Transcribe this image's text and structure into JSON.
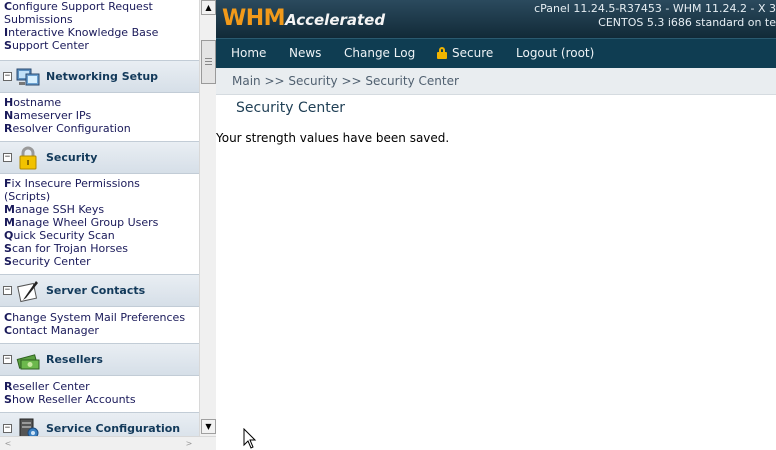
{
  "sidebar": {
    "top_links": [
      {
        "initial": "C",
        "rest": "onfigure Support Request"
      },
      {
        "initial": "",
        "rest": "Submissions"
      },
      {
        "initial": "I",
        "rest": "nteractive Knowledge Base"
      },
      {
        "initial": "S",
        "rest": "upport Center"
      }
    ],
    "sections": [
      {
        "title": "Networking Setup",
        "icon": "network-icon",
        "links": [
          {
            "initial": "H",
            "rest": "ostname"
          },
          {
            "initial": "N",
            "rest": "ameserver IPs"
          },
          {
            "initial": "R",
            "rest": "esolver Configuration"
          }
        ]
      },
      {
        "title": "Security",
        "icon": "padlock-icon",
        "links": [
          {
            "initial": "F",
            "rest": "ix Insecure Permissions"
          },
          {
            "initial": "",
            "rest": "(Scripts)"
          },
          {
            "initial": "M",
            "rest": "anage SSH Keys"
          },
          {
            "initial": "M",
            "rest": "anage Wheel Group Users"
          },
          {
            "initial": "Q",
            "rest": "uick Security Scan"
          },
          {
            "initial": "S",
            "rest": "can for Trojan Horses"
          },
          {
            "initial": "S",
            "rest": "ecurity Center"
          }
        ]
      },
      {
        "title": "Server Contacts",
        "icon": "contact-pen-icon",
        "links": [
          {
            "initial": "C",
            "rest": "hange System Mail Preferences"
          },
          {
            "initial": "C",
            "rest": "ontact Manager"
          }
        ]
      },
      {
        "title": "Resellers",
        "icon": "money-icon",
        "links": [
          {
            "initial": "R",
            "rest": "eseller Center"
          },
          {
            "initial": "S",
            "rest": "how Reseller Accounts"
          }
        ]
      },
      {
        "title": "Service Configuration",
        "icon": "server-gear-icon",
        "links": []
      }
    ],
    "collapse_symbol": "−"
  },
  "header": {
    "logo_main": "WHM",
    "logo_sub": "Accelerated",
    "version_line1": "cPanel 11.24.5-R37453 - WHM 11.24.2 - X 3",
    "version_line2": "CENTOS 5.3 i686 standard on te"
  },
  "nav": {
    "home": "Home",
    "news": "News",
    "changelog": "Change Log",
    "secure": "Secure",
    "logout": "Logout (root)"
  },
  "breadcrumb": "Main >> Security >> Security Center",
  "page_title": "Security Center",
  "message": "Your strength values have been saved.",
  "colors": {
    "header_bg": "#1b3646",
    "nav_bg": "#0f3d52",
    "logo_orange": "#f29a1a",
    "link": "#1a1a5a",
    "section_bg": "#dfe6ec"
  }
}
